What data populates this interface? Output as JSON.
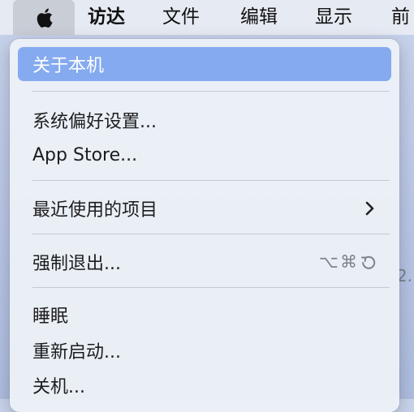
{
  "menubar": {
    "apple_icon": "apple-logo-icon",
    "items": [
      "访达",
      "文件",
      "编辑",
      "显示",
      "前"
    ]
  },
  "apple_menu": {
    "items": [
      {
        "label": "关于本机",
        "highlighted": true
      },
      {
        "label": "系统偏好设置..."
      },
      {
        "label": "App Store..."
      },
      {
        "label": "最近使用的项目",
        "submenu": true,
        "submenu_icon": "chevron-right-icon"
      },
      {
        "label": "强制退出...",
        "shortcut": "⌥⌘",
        "shortcut_icon": "escape-key-icon"
      },
      {
        "label": "睡眠"
      },
      {
        "label": "重新启动..."
      },
      {
        "label": "关机..."
      }
    ]
  },
  "background": {
    "peek_text": "2."
  },
  "colors": {
    "highlight": "#85aaef",
    "menu_bg": "#ecf0f7",
    "menubar_bg": "#e6eaf3",
    "apple_button_bg": "#c9cdd6",
    "shortcut_text": "#7d828b"
  }
}
